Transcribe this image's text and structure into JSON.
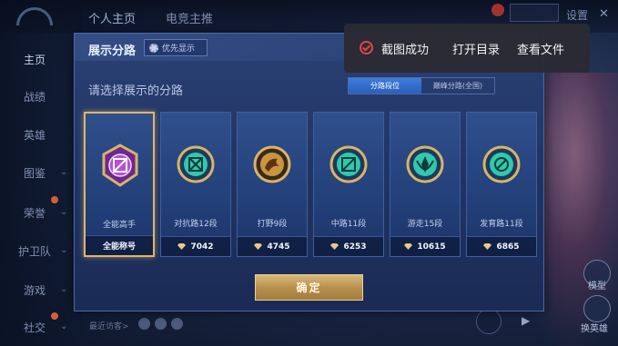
{
  "top_tabs": [
    "个人主页",
    "电竞主推"
  ],
  "top_settings": "设置",
  "sidebar": {
    "items": [
      {
        "label": "主页",
        "active": true
      },
      {
        "label": "战绩",
        "active": false
      },
      {
        "label": "英雄",
        "active": false
      },
      {
        "label": "图鉴",
        "active": false,
        "expandable": true
      },
      {
        "label": "荣誉",
        "active": false,
        "expandable": true
      },
      {
        "label": "护卫队",
        "active": false,
        "expandable": true
      },
      {
        "label": "游戏",
        "active": false,
        "expandable": true
      },
      {
        "label": "社交",
        "active": false,
        "expandable": true
      }
    ]
  },
  "bottom_hint": "最近访客>",
  "right_labels": [
    "模型",
    "换英雄"
  ],
  "dialog": {
    "title": "展示分路",
    "priority_chip": "优先显示",
    "subtitle": "请选择展示的分路",
    "segment": [
      "分路段位",
      "巅峰分路(全国)"
    ],
    "active_segment": 0,
    "cards": [
      {
        "name": "全能高手",
        "footer": "全能称号",
        "icon": "all-round-badge-icon",
        "selected": true,
        "color": "#b84fd6"
      },
      {
        "name": "对抗路12段",
        "score": "7042",
        "icon": "clash-lane-badge-icon",
        "selected": false,
        "color": "#2fc9b0"
      },
      {
        "name": "打野9段",
        "score": "4745",
        "icon": "jungle-badge-icon",
        "selected": false,
        "color": "#c99540"
      },
      {
        "name": "中路11段",
        "score": "6253",
        "icon": "mid-lane-badge-icon",
        "selected": false,
        "color": "#2fc9b0"
      },
      {
        "name": "游走15段",
        "score": "10615",
        "icon": "roam-badge-icon",
        "selected": false,
        "color": "#2fc9b0"
      },
      {
        "name": "发育路11段",
        "score": "6865",
        "icon": "farm-lane-badge-icon",
        "selected": false,
        "color": "#2fc9b0"
      }
    ],
    "confirm": "确定"
  },
  "toast": {
    "message": "截图成功",
    "open_dir": "打开目录",
    "view_file": "查看文件"
  },
  "colors": {
    "accent_gold": "#e0b56a",
    "active_blue": "#2a5fb8",
    "toast_bg": "#2a2a32",
    "toast_icon": "#e04646"
  }
}
